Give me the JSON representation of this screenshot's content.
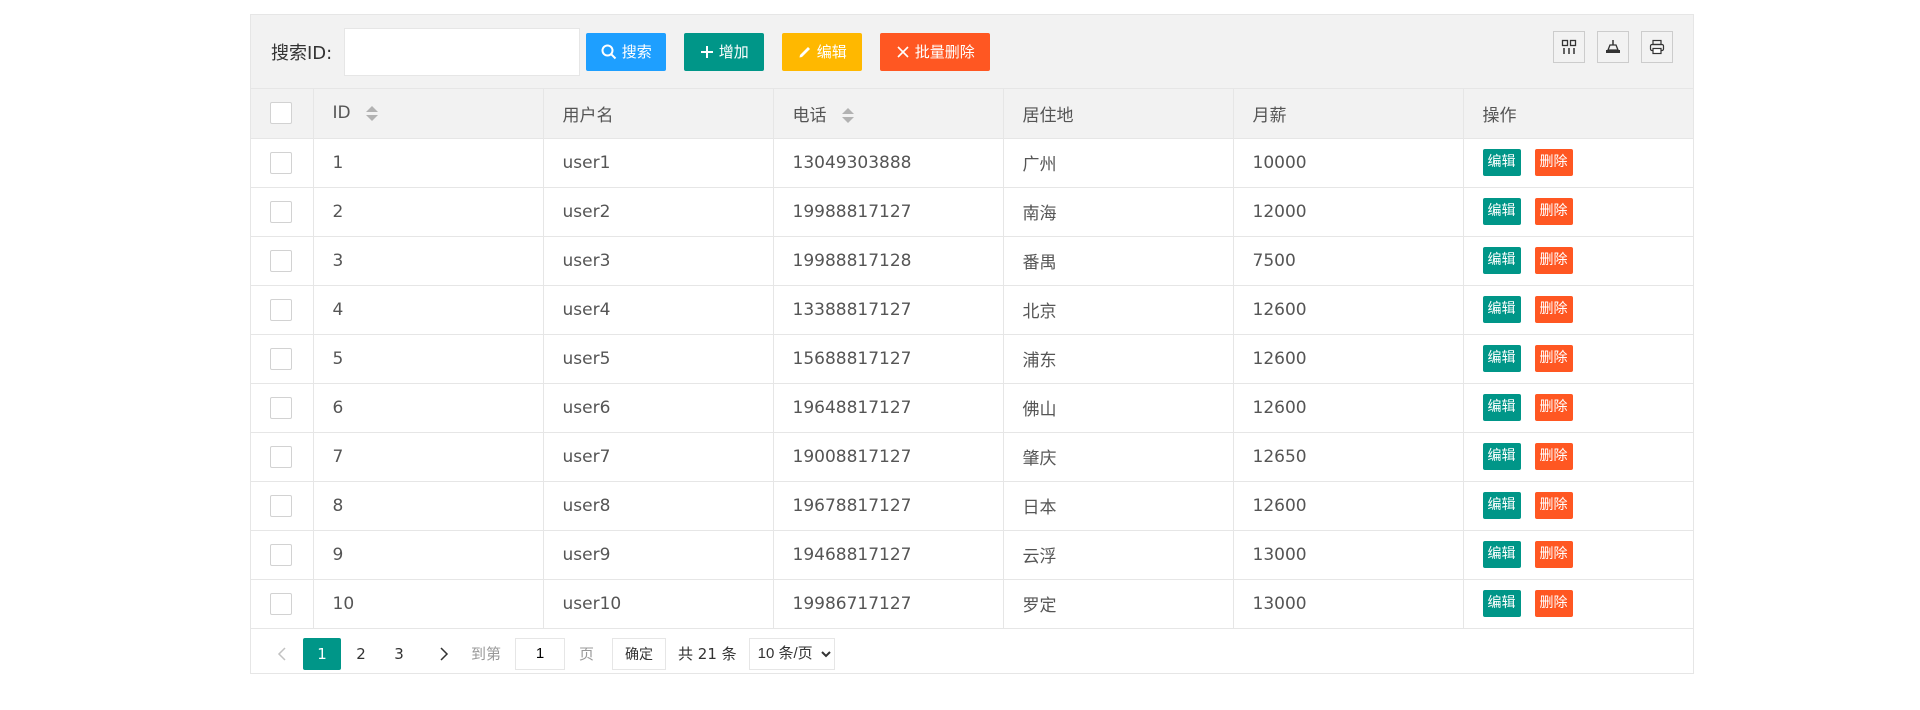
{
  "toolbar": {
    "search_label": "搜索ID:",
    "search_value": "",
    "search_button": "搜索",
    "add_button": "增加",
    "edit_button": "编辑",
    "batch_delete_button": "批量删除"
  },
  "table": {
    "columns": [
      "ID",
      "用户名",
      "电话",
      "居住地",
      "月薪",
      "操作"
    ],
    "rows": [
      {
        "id": "1",
        "username": "user1",
        "phone": "13049303888",
        "city": "广州",
        "salary": "10000"
      },
      {
        "id": "2",
        "username": "user2",
        "phone": "19988817127",
        "city": "南海",
        "salary": "12000"
      },
      {
        "id": "3",
        "username": "user3",
        "phone": "19988817128",
        "city": "番禺",
        "salary": "7500"
      },
      {
        "id": "4",
        "username": "user4",
        "phone": "13388817127",
        "city": "北京",
        "salary": "12600"
      },
      {
        "id": "5",
        "username": "user5",
        "phone": "15688817127",
        "city": "浦东",
        "salary": "12600"
      },
      {
        "id": "6",
        "username": "user6",
        "phone": "19648817127",
        "city": "佛山",
        "salary": "12600"
      },
      {
        "id": "7",
        "username": "user7",
        "phone": "19008817127",
        "city": "肇庆",
        "salary": "12650"
      },
      {
        "id": "8",
        "username": "user8",
        "phone": "19678817127",
        "city": "日本",
        "salary": "12600"
      },
      {
        "id": "9",
        "username": "user9",
        "phone": "19468817127",
        "city": "云浮",
        "salary": "13000"
      },
      {
        "id": "10",
        "username": "user10",
        "phone": "19986717127",
        "city": "罗定",
        "salary": "13000"
      }
    ],
    "row_edit": "编辑",
    "row_delete": "删除"
  },
  "pager": {
    "pages": [
      "1",
      "2",
      "3"
    ],
    "active_page": "1",
    "goto_prefix": "到第",
    "goto_value": "1",
    "goto_suffix": "页",
    "confirm": "确定",
    "total": "共 21 条",
    "page_size": "10 条/页"
  },
  "colors": {
    "blue": "#1e9fff",
    "green": "#009688",
    "yellow": "#ffb800",
    "red": "#ff5722"
  },
  "icons": [
    "search-icon",
    "plus-icon",
    "pencil-icon",
    "close-icon",
    "columns-icon",
    "export-icon",
    "print-icon",
    "chevron-left-icon",
    "chevron-right-icon"
  ]
}
